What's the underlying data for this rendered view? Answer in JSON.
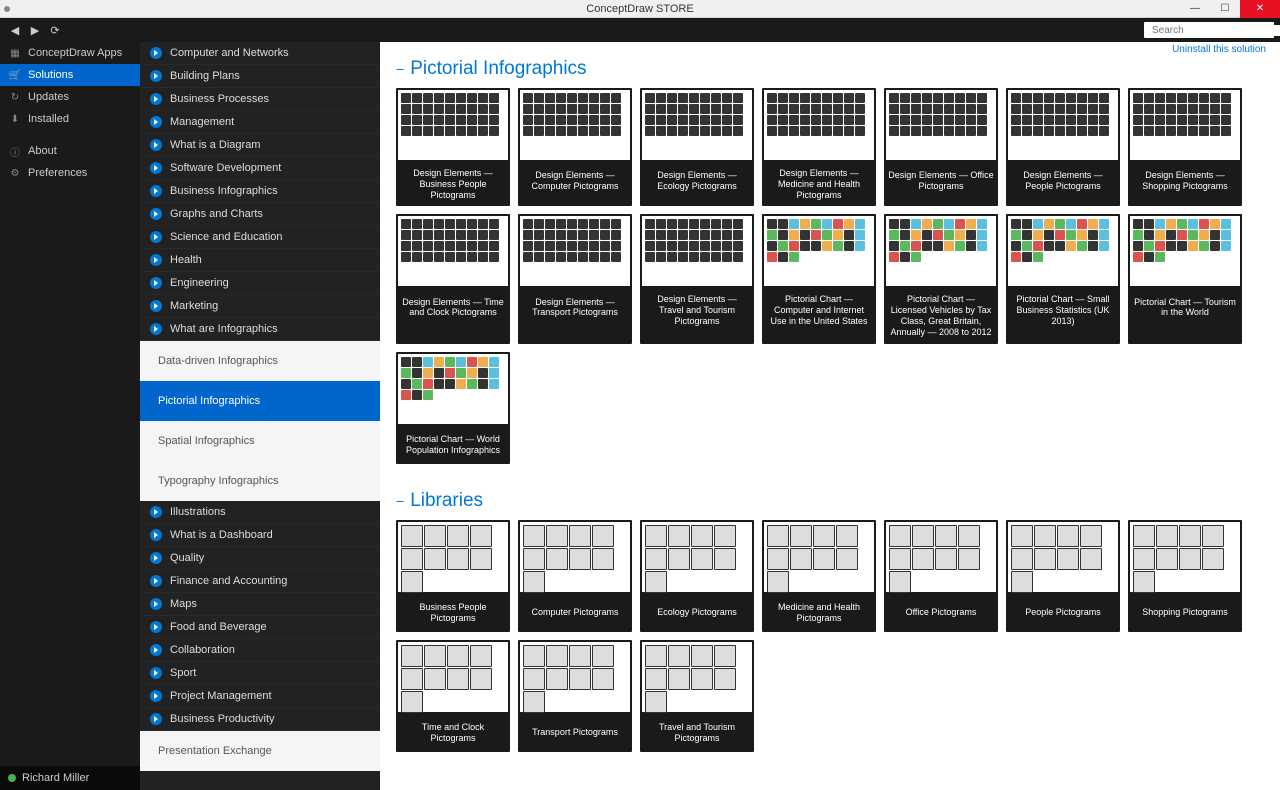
{
  "window": {
    "title": "ConceptDraw STORE"
  },
  "search": {
    "placeholder": "Search"
  },
  "sidebar_left": {
    "items": [
      {
        "label": "ConceptDraw Apps",
        "icon": "apps"
      },
      {
        "label": "Solutions",
        "icon": "cart",
        "active": true
      },
      {
        "label": "Updates",
        "icon": "refresh"
      },
      {
        "label": "Installed",
        "icon": "download"
      }
    ],
    "bottom": [
      {
        "label": "About",
        "icon": "info"
      },
      {
        "label": "Preferences",
        "icon": "gear"
      }
    ],
    "user": "Richard Miller"
  },
  "categories": [
    "Computer and Networks",
    "Building Plans",
    "Business Processes",
    "Management",
    "What is a Diagram",
    "Software Development",
    "Business Infographics",
    "Graphs and Charts",
    "Science and Education",
    "Health",
    "Engineering",
    "Marketing",
    "What are Infographics"
  ],
  "sub_categories": [
    {
      "label": "Data-driven Infographics",
      "active": false
    },
    {
      "label": "Pictorial Infographics",
      "active": true
    },
    {
      "label": "Spatial Infographics",
      "active": false
    },
    {
      "label": "Typography Infographics",
      "active": false
    }
  ],
  "categories_after": [
    "Illustrations",
    "What is a Dashboard",
    "Quality",
    "Finance and Accounting",
    "Maps",
    "Food and Beverage",
    "Collaboration",
    "Sport",
    "Project Management",
    "Business Productivity"
  ],
  "sub_after": [
    {
      "label": "Presentation Exchange",
      "active": false
    }
  ],
  "main": {
    "uninstall_label": "Uninstall this solution",
    "section1_title": "Pictorial Infographics",
    "section2_title": "Libraries",
    "cards1": [
      "Design Elements — Business People Pictograms",
      "Design Elements — Computer Pictograms",
      "Design Elements — Ecology Pictograms",
      "Design Elements — Medicine and Health Pictograms",
      "Design Elements — Office Pictograms",
      "Design Elements — People Pictograms",
      "Design Elements — Shopping Pictograms",
      "Design Elements — Time and Clock Pictograms",
      "Design Elements — Transport Pictograms",
      "Design Elements — Travel and Tourism Pictograms",
      "Pictorial Chart — Computer and Internet Use in the United States",
      "Pictorial Chart — Licensed Vehicles by Tax Class, Great Britain, Annually — 2008 to 2012",
      "Pictorial Chart — Small Business Statistics (UK 2013)",
      "Pictorial Chart — Tourism in the World",
      "Pictorial Chart — World Population Infographics"
    ],
    "color_thumbs": [
      10,
      11,
      12,
      13,
      14
    ],
    "cards2": [
      "Business People Pictograms",
      "Computer Pictograms",
      "Ecology Pictograms",
      "Medicine and Health Pictograms",
      "Office Pictograms",
      "People Pictograms",
      "Shopping Pictograms",
      "Time and Clock Pictograms",
      "Transport Pictograms",
      "Travel and Tourism Pictograms"
    ]
  }
}
